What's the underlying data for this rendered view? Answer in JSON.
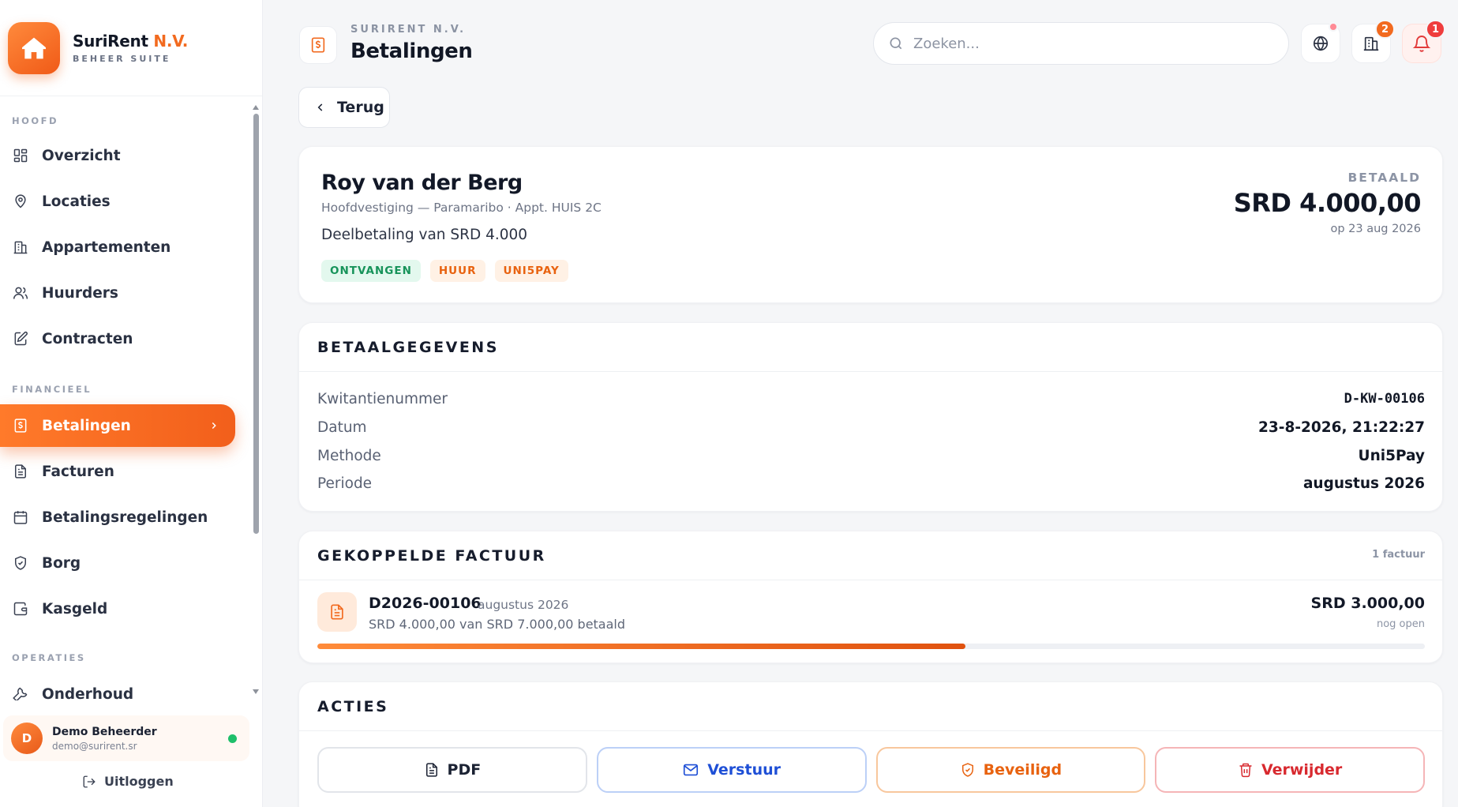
{
  "brand": {
    "name": "SuriRent",
    "name_accent": "N.V.",
    "subtitle": "BEHEER SUITE"
  },
  "sidebar": {
    "sections": [
      "HOOFD",
      "FINANCIEEL",
      "OPERATIES"
    ],
    "items": [
      {
        "label": "Overzicht",
        "icon": "grid-icon"
      },
      {
        "label": "Locaties",
        "icon": "map-pin-icon"
      },
      {
        "label": "Appartementen",
        "icon": "building-icon"
      },
      {
        "label": "Huurders",
        "icon": "users-icon"
      },
      {
        "label": "Contracten",
        "icon": "edit-document-icon"
      },
      {
        "label": "Betalingen",
        "icon": "receipt-dollar-icon",
        "active": true
      },
      {
        "label": "Facturen",
        "icon": "document-icon"
      },
      {
        "label": "Betalingsregelingen",
        "icon": "calendar-icon"
      },
      {
        "label": "Borg",
        "icon": "shield-icon"
      },
      {
        "label": "Kasgeld",
        "icon": "wallet-icon"
      },
      {
        "label": "Onderhoud",
        "icon": "wrench-icon"
      }
    ]
  },
  "user": {
    "initial": "D",
    "name": "Demo Beheerder",
    "email": "demo@surirent.sr",
    "status_color": "#1fbf6a"
  },
  "logout_label": "Uitloggen",
  "header": {
    "breadcrumb": "SURIRENT N.V.",
    "title": "Betalingen",
    "search_placeholder": "Zoeken...",
    "badges": {
      "buildings": "2",
      "notifications": "1"
    }
  },
  "back_label": "Terug",
  "payment": {
    "tenant": "Roy van der Berg",
    "location": "Hoofdvestiging — Paramaribo · Appt. HUIS 2C",
    "description": "Deelbetaling van SRD 4.000",
    "tags": [
      "ONTVANGEN",
      "HUUR",
      "UNI5PAY"
    ],
    "status_label": "BETAALD",
    "amount": "SRD 4.000,00",
    "date": "op 23 aug 2026"
  },
  "details": {
    "title": "BETAALGEGEVENS",
    "rows": [
      {
        "label": "Kwitantienummer",
        "value": "D-KW-00106"
      },
      {
        "label": "Datum",
        "value": "23-8-2026, 21:22:27"
      },
      {
        "label": "Methode",
        "value": "Uni5Pay"
      },
      {
        "label": "Periode",
        "value": "augustus 2026"
      }
    ]
  },
  "invoice": {
    "title": "GEKOPPELDE FACTUUR",
    "count": "1 factuur",
    "number": "D2026-00106",
    "period": "augustus 2026",
    "paid_text": "SRD 4.000,00 van SRD 7.000,00 betaald",
    "open_amount": "SRD 3.000,00",
    "open_label": "nog open",
    "progress_fraction": 0.585
  },
  "actions": {
    "title": "ACTIES",
    "pdf": "PDF",
    "send": "Verstuur",
    "secure": "Beveiligd",
    "delete": "Verwijder"
  },
  "colors": {
    "accent": "#f26a1f",
    "send": "#1e4fd6",
    "danger": "#d8292f",
    "success": "#17935a"
  }
}
